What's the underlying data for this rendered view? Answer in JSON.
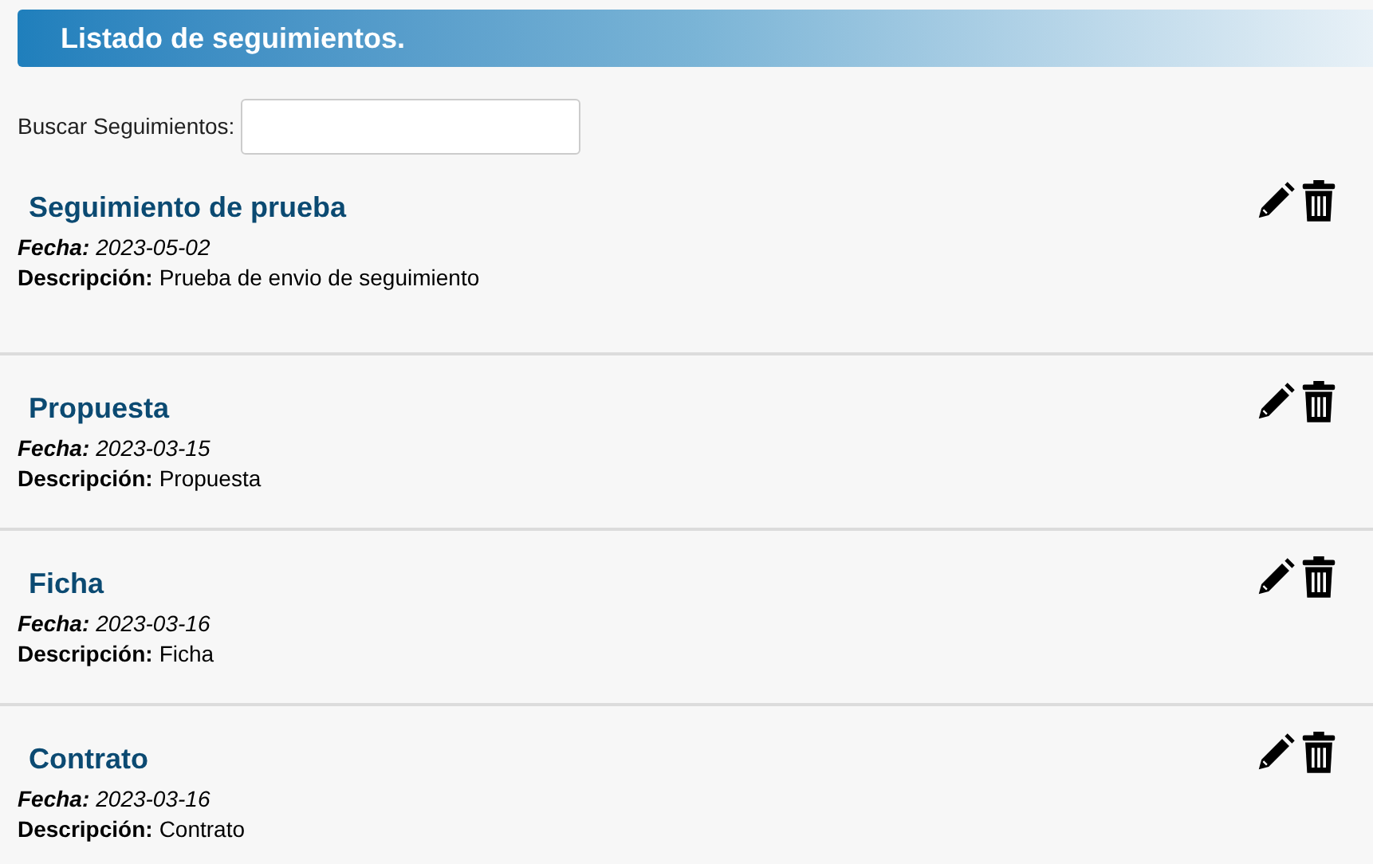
{
  "header": {
    "title": "Listado de seguimientos."
  },
  "search": {
    "label": "Buscar Seguimientos:"
  },
  "items": [
    {
      "title": "Seguimiento de prueba",
      "date_label": "Fecha:",
      "date": "2023-05-02",
      "description_label": "Descripción:",
      "description": "Prueba de envio de seguimiento"
    },
    {
      "title": "Propuesta",
      "date_label": "Fecha:",
      "date": "2023-03-15",
      "description_label": "Descripción:",
      "description": "Propuesta"
    },
    {
      "title": "Ficha",
      "date_label": "Fecha:",
      "date": "2023-03-16",
      "description_label": "Descripción:",
      "description": "Ficha"
    },
    {
      "title": "Contrato",
      "date_label": "Fecha:",
      "date": "2023-03-16",
      "description_label": "Descripción:",
      "description": "Contrato"
    }
  ]
}
